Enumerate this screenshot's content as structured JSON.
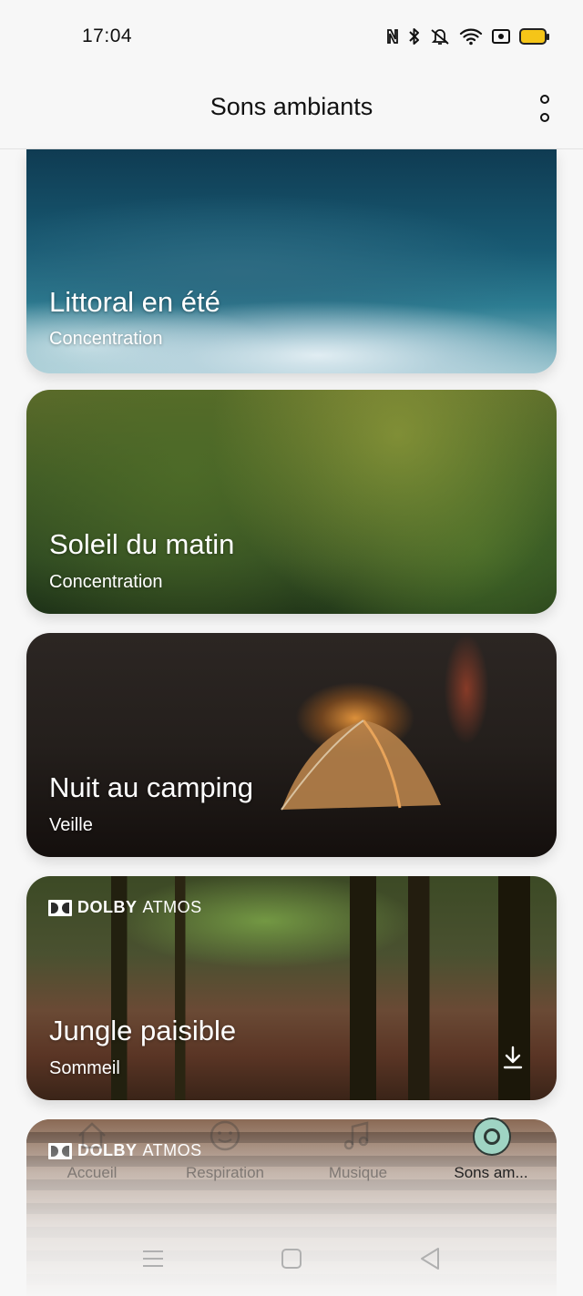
{
  "status_bar": {
    "time": "17:04",
    "icons": [
      "nfc-icon",
      "bluetooth-icon",
      "vibrate-icon",
      "wifi-icon",
      "screen-record-icon",
      "battery-icon"
    ]
  },
  "app_bar": {
    "title": "Sons ambiants",
    "menu_icon": "more-vertical-icon"
  },
  "cards": [
    {
      "title": "Littoral en été",
      "subtitle": "Concentration",
      "dolby": false,
      "download": false
    },
    {
      "title": "Soleil du matin",
      "subtitle": "Concentration",
      "dolby": false,
      "download": false
    },
    {
      "title": "Nuit au camping",
      "subtitle": "Veille",
      "dolby": false,
      "download": false
    },
    {
      "title": "Jungle paisible",
      "subtitle": "Sommeil",
      "dolby": true,
      "download": true
    },
    {
      "title": "",
      "subtitle": "",
      "dolby": true,
      "download": false
    }
  ],
  "dolby": {
    "brand": "DOLBY",
    "suffix": "ATMOS"
  },
  "bottom_nav": [
    {
      "label": "Accueil",
      "icon": "home-icon",
      "active": false
    },
    {
      "label": "Respiration",
      "icon": "breathing-icon",
      "active": false
    },
    {
      "label": "Musique",
      "icon": "music-icon",
      "active": false
    },
    {
      "label": "Sons am...",
      "icon": "ambient-sounds-icon",
      "active": true
    }
  ],
  "system_nav": [
    "menu-icon",
    "home-square-icon",
    "back-triangle-icon"
  ],
  "colors": {
    "background": "#f7f7f7",
    "battery": "#f5c518",
    "active_tab": "#9fd4c3"
  }
}
